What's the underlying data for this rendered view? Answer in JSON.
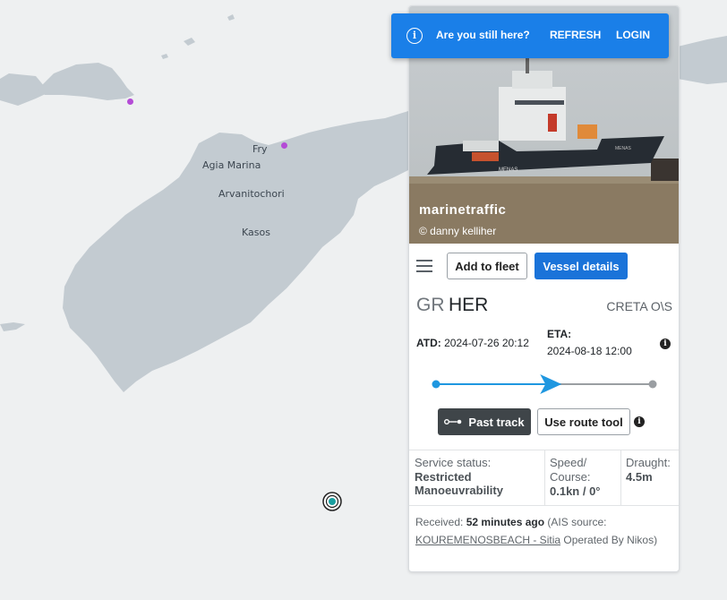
{
  "map": {
    "labels": {
      "fry": "Fry",
      "agia_marina": "Agia Marina",
      "arvanitochori": "Arvanitochori",
      "kasos": "Kasos"
    },
    "colors": {
      "sea": "#eef0f1",
      "land": "#c3cbd1",
      "port_dot": "#b44bd6",
      "vessel_marker": "#1a9fa0"
    }
  },
  "banner": {
    "message": "Are you still here?",
    "refresh_label": "REFRESH",
    "login_label": "LOGIN",
    "icon": "info-icon",
    "color": "#1a7fe8"
  },
  "vessel_panel": {
    "photo": {
      "brand": "marinetraffic",
      "credit": "© danny kelliher",
      "ship_name_on_hull": "MENAS"
    },
    "toolbar": {
      "add_to_fleet": "Add to fleet",
      "vessel_details": "Vessel details"
    },
    "destination": {
      "country": "GR",
      "port": "HER",
      "name": "CRETA O\\S"
    },
    "voyage": {
      "atd_label": "ATD:",
      "atd_value": "2024-07-26 20:12",
      "eta_label": "ETA:",
      "eta_value": "2024-08-18 12:00",
      "progress_fraction": 0.53
    },
    "actions": {
      "past_track": "Past track",
      "route_tool": "Use route tool"
    },
    "stats": {
      "service_status_label": "Service status:",
      "service_status_value_line1": "Restricted",
      "service_status_value_line2": "Manoeuvrability",
      "speed_label_line1": "Speed/",
      "speed_label_line2": "Course:",
      "speed_value": "0.1kn / 0°",
      "draught_label": "Draught:",
      "draught_value": "4.5m"
    },
    "received": {
      "label": "Received:",
      "age": "52 minutes ago",
      "ais_source_prefix": "(AIS source:",
      "station": "KOUREMENOSBEACH - Sitia",
      "operated_by": "Operated By",
      "operator": "Nikos)"
    }
  }
}
